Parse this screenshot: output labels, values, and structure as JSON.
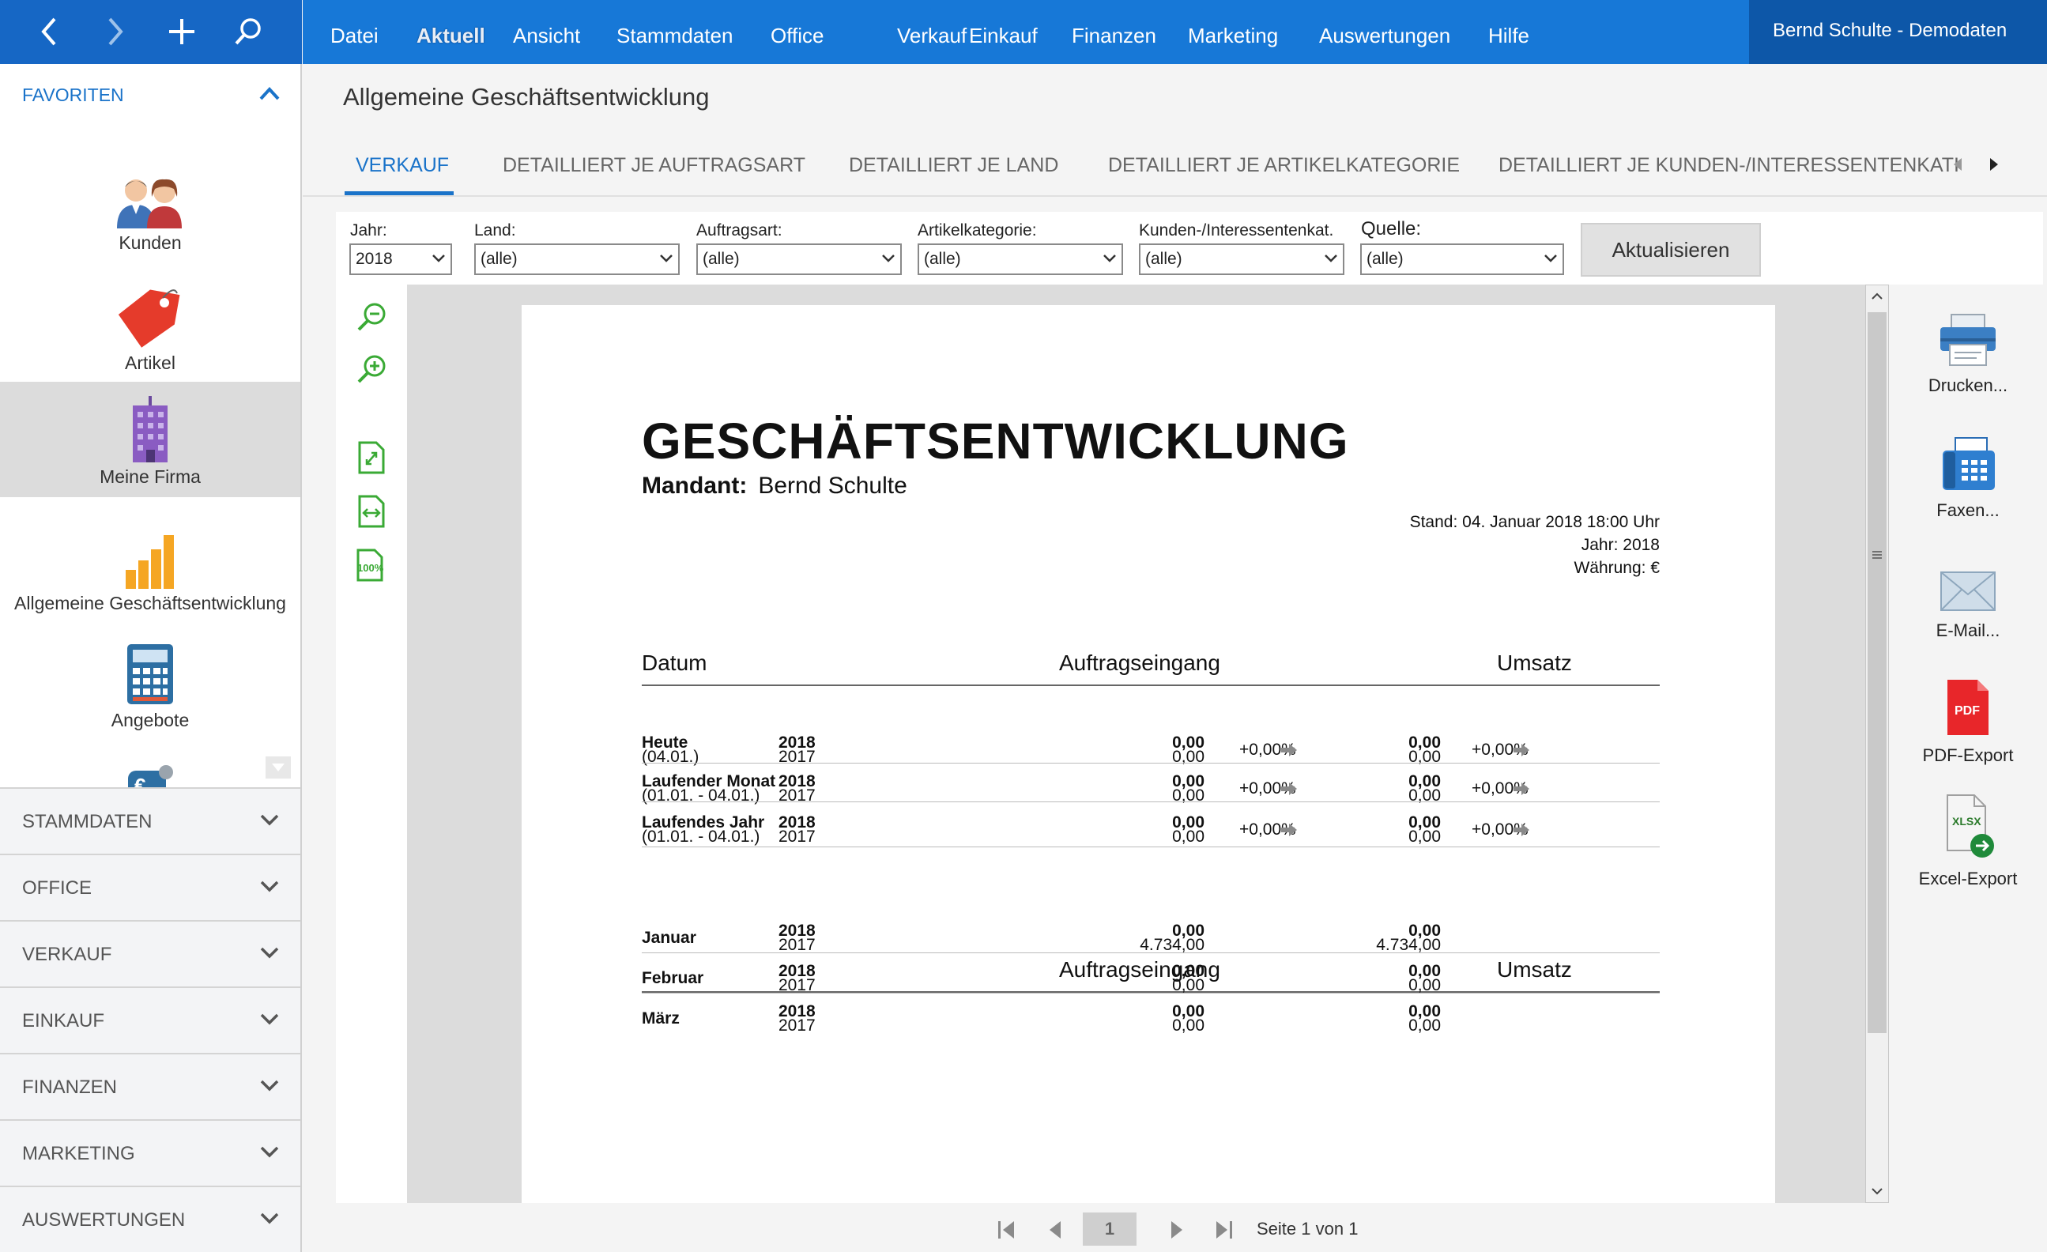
{
  "app": {
    "user_label": "Bernd Schulte - Demodaten",
    "menu": [
      "Datei",
      "Aktuell",
      "Ansicht",
      "Stammdaten",
      "Office",
      "Verkauf",
      "Einkauf",
      "Finanzen",
      "Marketing",
      "Auswertungen",
      "Hilfe"
    ],
    "active_menu": "Aktuell",
    "colors": {
      "menubar": "#1778d7",
      "accent": "#1a73c9"
    }
  },
  "sidebar": {
    "favorites_header": "FAVORITEN",
    "favorites": [
      {
        "label": "Kunden",
        "icon": "users-icon"
      },
      {
        "label": "Artikel",
        "icon": "price-tag-icon"
      },
      {
        "label": "Meine Firma",
        "icon": "office-building-icon",
        "selected": true
      },
      {
        "label": "Allgemeine Geschäftsentwicklung",
        "icon": "bar-chart-icon"
      },
      {
        "label": "Angebote",
        "icon": "calculator-icon"
      }
    ],
    "sections": [
      "STAMMDATEN",
      "OFFICE",
      "VERKAUF",
      "EINKAUF",
      "FINANZEN",
      "MARKETING",
      "AUSWERTUNGEN"
    ]
  },
  "page": {
    "title": "Allgemeine Geschäftsentwicklung",
    "tabs": [
      "VERKAUF",
      "DETAILLIERT JE AUFTRAGSART",
      "DETAILLIERT JE LAND",
      "DETAILLIERT JE ARTIKELKATEGORIE",
      "DETAILLIERT JE KUNDEN-/INTERESSENTENKATI"
    ],
    "active_tab": "VERKAUF"
  },
  "filters": {
    "jahr": {
      "label": "Jahr:",
      "value": "2018"
    },
    "land": {
      "label": "Land:",
      "value": "(alle)"
    },
    "auftragsart": {
      "label": "Auftragsart:",
      "value": "(alle)"
    },
    "artikelkategorie": {
      "label": "Artikelkategorie:",
      "value": "(alle)"
    },
    "kundenkat": {
      "label": "Kunden-/Interessentenkat.",
      "value": "(alle)"
    },
    "quelle": {
      "label": "Quelle:",
      "value": "(alle)"
    },
    "refresh_label": "Aktualisieren"
  },
  "export": [
    {
      "label": "Drucken...",
      "icon": "printer-icon"
    },
    {
      "label": "Faxen...",
      "icon": "fax-icon"
    },
    {
      "label": "E-Mail...",
      "icon": "envelope-icon"
    },
    {
      "label": "PDF-Export",
      "icon": "pdf-file-icon",
      "badge": "PDF"
    },
    {
      "label": "Excel-Export",
      "icon": "xlsx-file-icon",
      "badge": "XLSX"
    }
  ],
  "pager": {
    "current": "1",
    "text": "Seite 1 von 1"
  },
  "zoom_100_label": "100%",
  "report": {
    "title": "GESCHÄFTSENTWICKLUNG",
    "mandant_label": "Mandant:",
    "mandant": "Bernd Schulte",
    "stand": "Stand:  04. Januar 2018 18:00 Uhr",
    "jahr": "Jahr: 2018",
    "waehrung": "Währung: €",
    "col_datum": "Datum",
    "col_auftrag": "Auftragseingang",
    "col_umsatz": "Umsatz",
    "summary_rows": [
      {
        "name": "Heute",
        "range": "(04.01.)",
        "y1": "2018",
        "y2": "2017",
        "a1": "0,00",
        "a2": "0,00",
        "ap": "+0,00%",
        "u1": "0,00",
        "u2": "0,00",
        "up": "+0,00%"
      },
      {
        "name": "Laufender Monat",
        "range": "(01.01. - 04.01.)",
        "y1": "2018",
        "y2": "2017",
        "a1": "0,00",
        "a2": "0,00",
        "ap": "+0,00%",
        "u1": "0,00",
        "u2": "0,00",
        "up": "+0,00%"
      },
      {
        "name": "Laufendes Jahr",
        "range": "(01.01. - 04.01.)",
        "y1": "2018",
        "y2": "2017",
        "a1": "0,00",
        "a2": "0,00",
        "ap": "+0,00%",
        "u1": "0,00",
        "u2": "0,00",
        "up": "+0,00%"
      }
    ],
    "month_rows": [
      {
        "name": "Januar",
        "y1": "2018",
        "y2": "2017",
        "a1": "0,00",
        "a2": "4.734,00",
        "u1": "0,00",
        "u2": "4.734,00"
      },
      {
        "name": "Februar",
        "y1": "2018",
        "y2": "2017",
        "a1": "0,00",
        "a2": "0,00",
        "u1": "0,00",
        "u2": "0,00"
      },
      {
        "name": "März",
        "y1": "2018",
        "y2": "2017",
        "a1": "0,00",
        "a2": "0,00",
        "u1": "0,00",
        "u2": "0,00"
      }
    ]
  }
}
